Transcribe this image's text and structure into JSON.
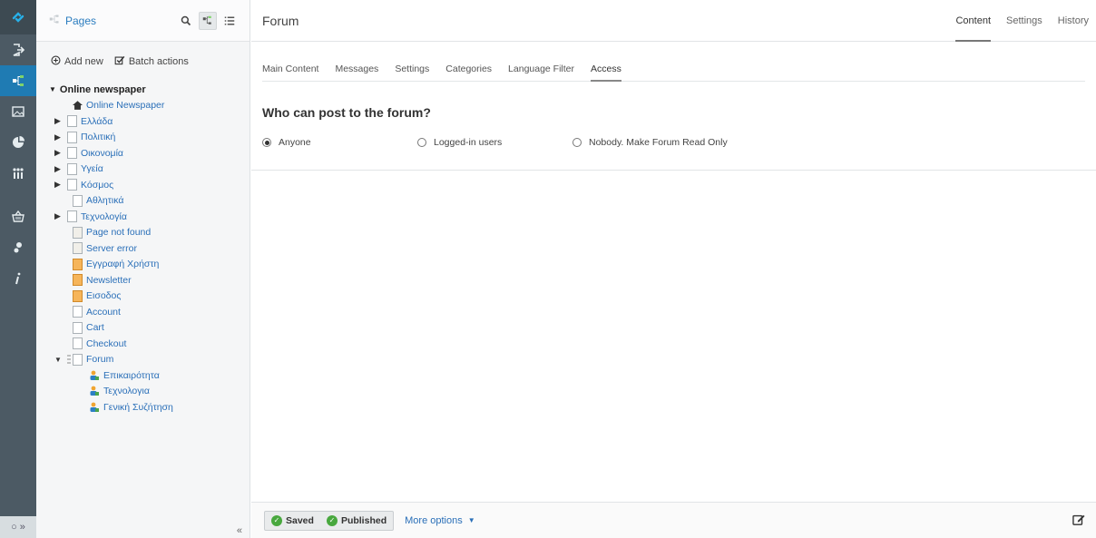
{
  "tree": {
    "title": "Pages",
    "add_new": "Add new",
    "batch_actions": "Batch actions",
    "root": "Online newspaper",
    "nodes": [
      {
        "label": "Online Newspaper"
      },
      {
        "label": "Ελλάδα"
      },
      {
        "label": "Πολιτική"
      },
      {
        "label": "Οικονομία"
      },
      {
        "label": "Υγεία"
      },
      {
        "label": "Κόσμος"
      },
      {
        "label": "Αθλητικά"
      },
      {
        "label": "Τεχνολογία"
      },
      {
        "label": "Page not found"
      },
      {
        "label": "Server error"
      },
      {
        "label": "Εγγραφή Χρήστη"
      },
      {
        "label": "Newsletter"
      },
      {
        "label": "Εισοδος"
      },
      {
        "label": "Account"
      },
      {
        "label": "Cart"
      },
      {
        "label": "Checkout"
      },
      {
        "label": "Forum"
      },
      {
        "label": "Επικαιρότητα"
      },
      {
        "label": "Τεχνολογια"
      },
      {
        "label": "Γενική Συζήτηση"
      }
    ],
    "collapse": "«"
  },
  "rail": {
    "bottom": "○ »"
  },
  "main": {
    "title": "Forum",
    "top_tabs": [
      "Content",
      "Settings",
      "History"
    ],
    "sub_tabs": [
      "Main Content",
      "Messages",
      "Settings",
      "Categories",
      "Language Filter",
      "Access"
    ],
    "question": "Who can post to the forum?",
    "options": [
      "Anyone",
      "Logged-in users",
      "Nobody. Make Forum Read Only"
    ]
  },
  "footer": {
    "saved": "Saved",
    "published": "Published",
    "more_options": "More options"
  }
}
